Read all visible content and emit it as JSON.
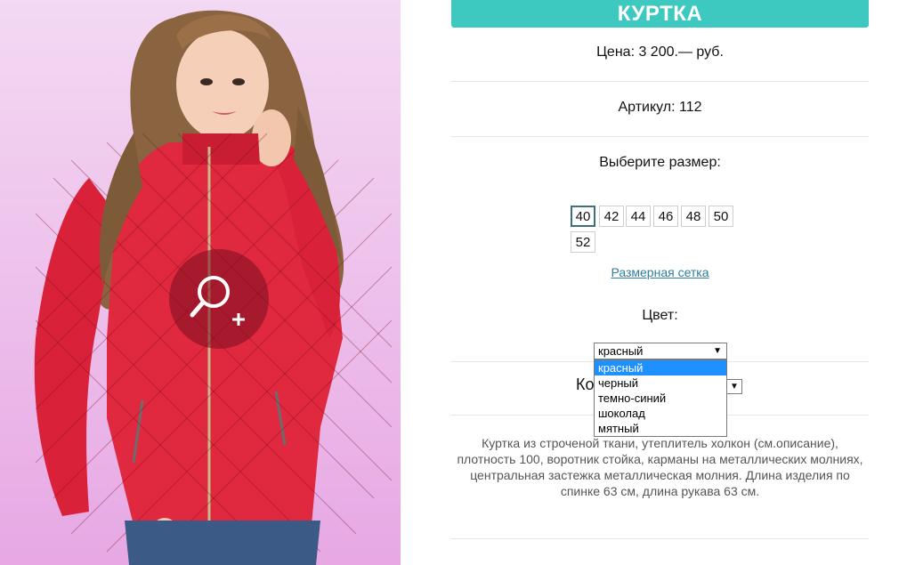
{
  "product": {
    "title": "КУРТКА",
    "price": "Цена: 3 200.— руб.",
    "article": "Артикул: 112",
    "choose_size": "Выберите размер:",
    "sizes": [
      "40",
      "42",
      "44",
      "46",
      "48",
      "50",
      "52"
    ],
    "selected_size": "40",
    "size_chart_link": "Размерная сетка",
    "color_label": "Цвет:",
    "color_select": {
      "value": "красный",
      "options": [
        "красный",
        "черный",
        "темно-синий",
        "шоколад",
        "мятный"
      ]
    },
    "quantity_label_partial": "Ко",
    "description": "Куртка из строченой ткани, утеплитель холкон (см.описание), плотность 100, воротник стойка, карманы на металлических молниях, центральная застежка металлическая молния. Длина изделия по спинке 63 см, длина рукава 63 см.",
    "cut_off_text": "    "
  },
  "colors": {
    "accent": "#3ec9c0",
    "link": "#2e7fa0",
    "dropdown_highlight": "#1e90ff",
    "jacket": "#e0283f"
  },
  "icons": {
    "zoom": "zoom-in-icon",
    "dropdown": "chevron-down-icon"
  }
}
